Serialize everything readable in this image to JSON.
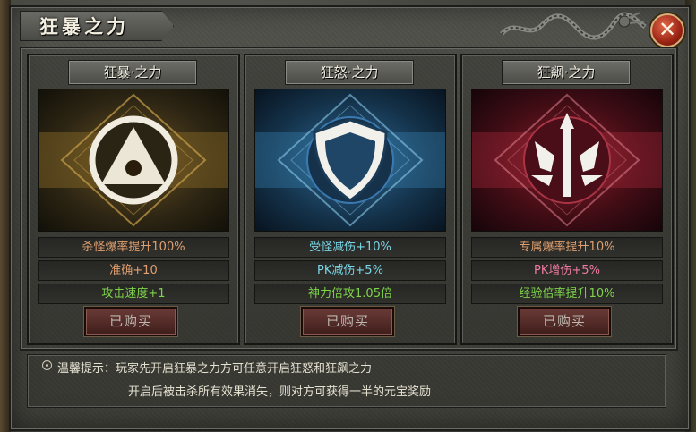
{
  "window": {
    "title": "狂暴之力",
    "close_label": "✕"
  },
  "panels": [
    {
      "title": "狂暴·之力",
      "emblem": "triangle-eye-icon",
      "theme": "gold",
      "stats": [
        {
          "text": "杀怪爆率提升100%",
          "color": "#e0a070"
        },
        {
          "text": "准确+10",
          "color": "#e0a070"
        },
        {
          "text": "攻击速度+1",
          "color": "#7ed44a"
        }
      ],
      "button_label": "已购买"
    },
    {
      "title": "狂怒·之力",
      "emblem": "shield-icon",
      "theme": "blue",
      "stats": [
        {
          "text": "受怪减伤+10%",
          "color": "#7ad6e6"
        },
        {
          "text": "PK减伤+5%",
          "color": "#7ad6e6"
        },
        {
          "text": "神力倍攻1.05倍",
          "color": "#7ed44a"
        }
      ],
      "button_label": "已购买"
    },
    {
      "title": "狂飙·之力",
      "emblem": "trident-icon",
      "theme": "red",
      "stats": [
        {
          "text": "专属爆率提升10%",
          "color": "#e0a070"
        },
        {
          "text": "PK增伤+5%",
          "color": "#ee7aa0"
        },
        {
          "text": "经验倍率提升10%",
          "color": "#7ed44a"
        }
      ],
      "button_label": "已购买"
    }
  ],
  "tips": {
    "line1": "温馨提示：玩家先开启狂暴之力方可任意开启狂怒和狂飙之力",
    "line2": "开启后被击杀所有效果消失，则对方可获得一半的元宝奖励"
  },
  "colors": {
    "gold": "#b88a2a",
    "blue": "#2a6fa8",
    "red": "#a82434"
  }
}
